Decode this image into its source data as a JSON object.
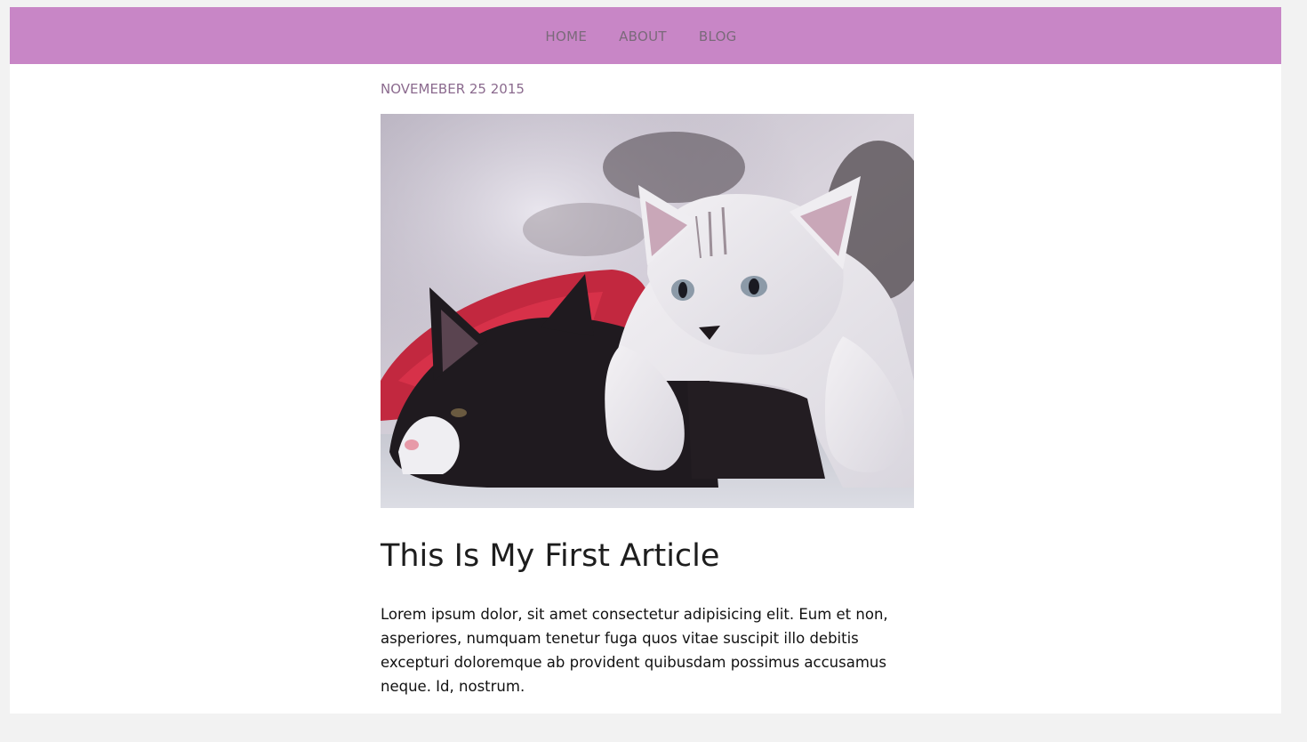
{
  "nav": {
    "items": [
      {
        "label": "HOME"
      },
      {
        "label": "ABOUT"
      },
      {
        "label": "BLOG"
      }
    ]
  },
  "article": {
    "date": "NOVEMEBER 25 2015",
    "image_alt": "Two kittens",
    "title": "This Is My First Article",
    "body": "Lorem ipsum dolor, sit amet consectetur adipisicing elit. Eum et non, asperiores, numquam tenetur fuga quos vitae suscipit illo debitis excepturi doloremque ab provident quibusdam possimus accusamus neque. Id, nostrum."
  },
  "colors": {
    "nav_background": "#c886c6",
    "nav_text": "#7a6a7a",
    "date_text": "#8b6a8e",
    "page_background": "#f2f2f2"
  }
}
